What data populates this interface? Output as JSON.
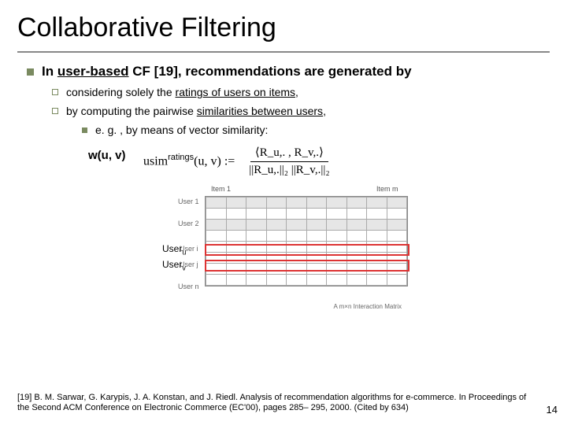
{
  "title": "Collaborative Filtering",
  "b1_prefix": "In ",
  "b1_underlined": "user-based",
  "b1_suffix": " CF [19], recommendations are generated by",
  "b2a_prefix": "considering solely the ",
  "b2a_underlined": "ratings of users on items",
  "b2a_suffix": ",",
  "b2b_prefix": "by computing the pairwise ",
  "b2b_underlined": "similarities between users",
  "b2b_suffix": ",",
  "b3": "e. g. , by means of vector similarity:",
  "wuv": "w(u, v)",
  "formula_left": "usim",
  "formula_super": "ratings",
  "formula_args": "(u, v) :=",
  "formula_num": "⟨R_u,. , R_v,.⟩",
  "formula_den": "||R_u,.||₂ ||R_v,.||₂",
  "hdr_first": "Item 1",
  "hdr_last": "Item m",
  "row1": "User 1",
  "row2": "User 2",
  "rowi": "User i",
  "rowj": "User j",
  "rown": "User n",
  "useru": "User",
  "useru_sub": "u",
  "userv": "User",
  "userv_sub": "v",
  "matrix_caption": "A m×n Interaction Matrix",
  "reference": "[19] B. M. Sarwar, G. Karypis, J. A. Konstan, and J. Riedl. Analysis of recommendation algorithms for e-commerce. In Proceedings of the Second ACM Conference on Electronic Commerce (EC'00), pages 285– 295, 2000. (Cited by 634)",
  "slide_number": "14"
}
